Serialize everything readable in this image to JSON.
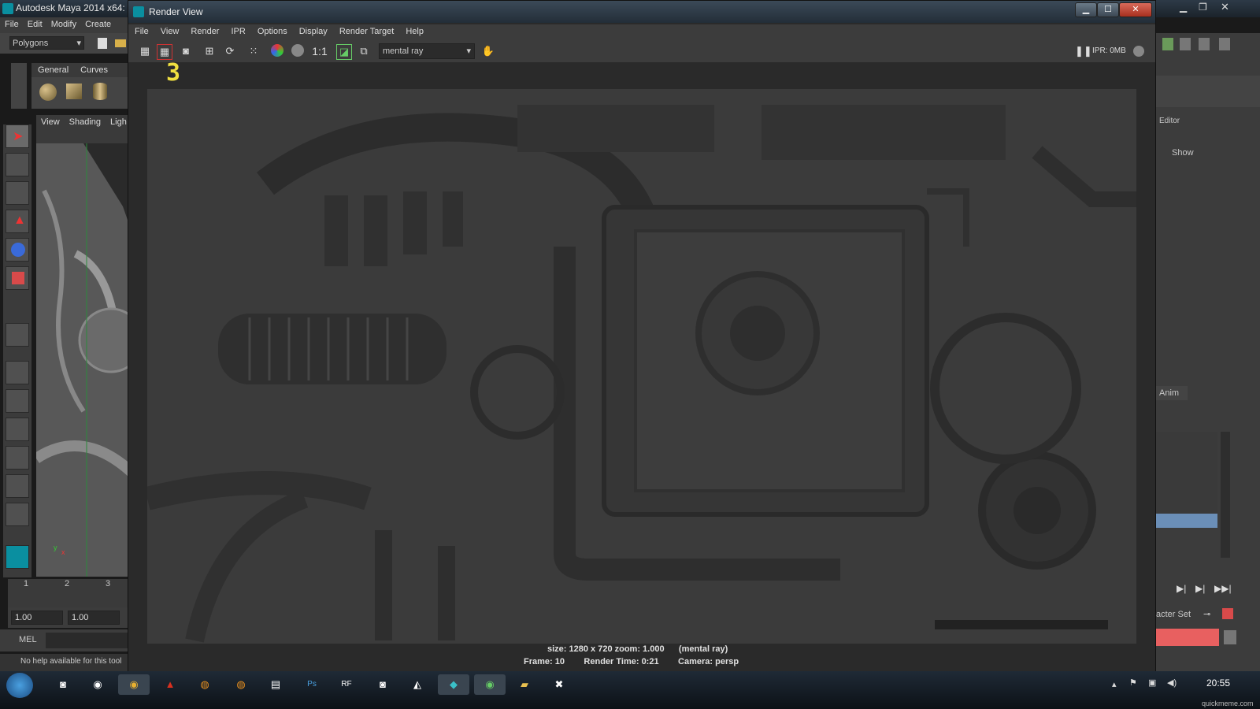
{
  "maya": {
    "title": "Autodesk Maya 2014 x64:",
    "menu": [
      "File",
      "Edit",
      "Modify",
      "Create"
    ],
    "mode_select": "Polygons",
    "shelf_tabs": [
      "General",
      "Curves"
    ],
    "viewport_menu": [
      "View",
      "Shading",
      "Ligh"
    ],
    "timeline_ticks": [
      "1",
      "2",
      "3"
    ],
    "range_start": "1.00",
    "range_end": "1.00",
    "mel_label": "MEL",
    "help_line": "No help available for this tool",
    "right_panel": {
      "editor_label": "Editor",
      "show_label": "Show",
      "anim_tab": "Anim",
      "character_set": "acter Set"
    }
  },
  "render_view": {
    "title": "Render View",
    "menu": [
      "File",
      "View",
      "Render",
      "IPR",
      "Options",
      "Display",
      "Render Target",
      "Help"
    ],
    "ratio_label": "1:1",
    "renderer": "mental ray",
    "ipr_status": "IPR: 0MB",
    "frame_marker": "3",
    "info_line1": "size: 1280 x 720 zoom: 1.000      (mental ray)",
    "info_line2": "Frame: 10        Render Time: 0:21        Camera: persp"
  },
  "taskbar": {
    "clock": "20:55",
    "watermark": "quickmeme.com",
    "apps": [
      "windows-start",
      "cmd",
      "chrome-alt",
      "chrome",
      "acrobat",
      "blender",
      "blender2",
      "notes",
      "photoshop",
      "realflow",
      "steam",
      "gimp",
      "maya",
      "utorrent",
      "explorer",
      "tool"
    ]
  }
}
